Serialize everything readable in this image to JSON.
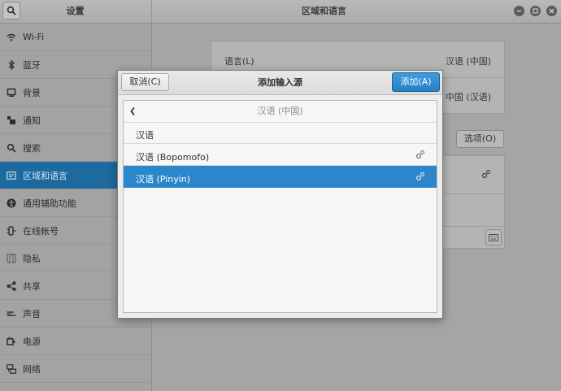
{
  "window": {
    "sidebar_title": "设置",
    "title": "区域和语言"
  },
  "sidebar": {
    "items": [
      {
        "label": "Wi-Fi",
        "icon": "wifi-icon"
      },
      {
        "label": "蓝牙",
        "icon": "bluetooth-icon"
      },
      {
        "label": "背景",
        "icon": "background-icon"
      },
      {
        "label": "通知",
        "icon": "notification-icon"
      },
      {
        "label": "搜索",
        "icon": "search-icon"
      },
      {
        "label": "区域和语言",
        "icon": "region-icon",
        "active": true
      },
      {
        "label": "通用辅助功能",
        "icon": "accessibility-icon"
      },
      {
        "label": "在线帐号",
        "icon": "online-accounts-icon"
      },
      {
        "label": "隐私",
        "icon": "privacy-icon"
      },
      {
        "label": "共享",
        "icon": "share-icon"
      },
      {
        "label": "声音",
        "icon": "sound-icon"
      },
      {
        "label": "电源",
        "icon": "power-icon"
      },
      {
        "label": "网络",
        "icon": "network-icon"
      }
    ]
  },
  "main": {
    "language_label": "语言(L)",
    "language_value": "汉语 (中国)",
    "formats_value": "中国 (汉语)",
    "options_button": "选项(O)"
  },
  "dialog": {
    "title": "添加输入源",
    "cancel_label": "取消(C)",
    "add_label": "添加(A)",
    "list_header": "汉语 (中国)",
    "items": [
      {
        "label": "汉语"
      },
      {
        "label": "汉语 (Bopomofo)"
      },
      {
        "label": "汉语 (Pinyin)"
      }
    ]
  },
  "colors": {
    "accent": "#2b86cb",
    "sidebar_active": "#1d6aa0"
  }
}
